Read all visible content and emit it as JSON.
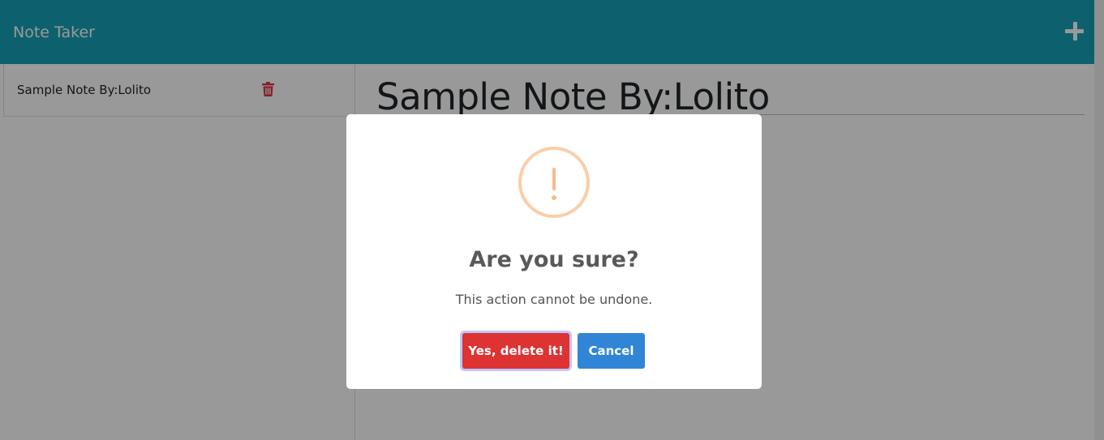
{
  "navbar": {
    "brand": "Note Taker",
    "add_icon": "plus-icon",
    "color": "#17a2b8"
  },
  "sidebar": {
    "notes": [
      {
        "title": "Sample Note By:Lolito",
        "delete_icon": "trash-icon"
      }
    ]
  },
  "main": {
    "note_title": "Sample Note By:Lolito"
  },
  "dialog": {
    "icon": "warning-icon",
    "title": "Are you sure?",
    "text": "This action cannot be undone.",
    "confirm_label": "Yes, delete it!",
    "cancel_label": "Cancel",
    "confirm_color": "#dd3333",
    "cancel_color": "#3085d6"
  }
}
